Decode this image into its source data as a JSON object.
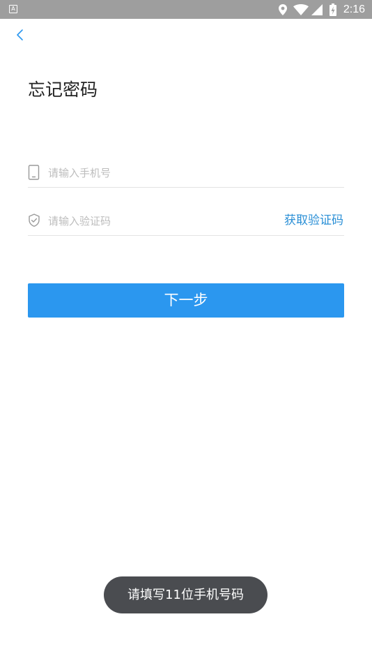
{
  "status_bar": {
    "app_icon_letter": "A",
    "time": "2:16"
  },
  "page": {
    "title": "忘记密码"
  },
  "form": {
    "phone": {
      "placeholder": "请输入手机号",
      "value": "",
      "icon": "phone-icon"
    },
    "code": {
      "placeholder": "请输入验证码",
      "value": "",
      "icon": "shield-check-icon"
    },
    "get_code_label": "获取验证码",
    "next_label": "下一步"
  },
  "toast": {
    "message": "请填写11位手机号码"
  },
  "colors": {
    "accent": "#2b97ef",
    "link": "#2a8fd6",
    "status_bar": "#9e9e9e",
    "toast_bg": "#4a4c50"
  }
}
